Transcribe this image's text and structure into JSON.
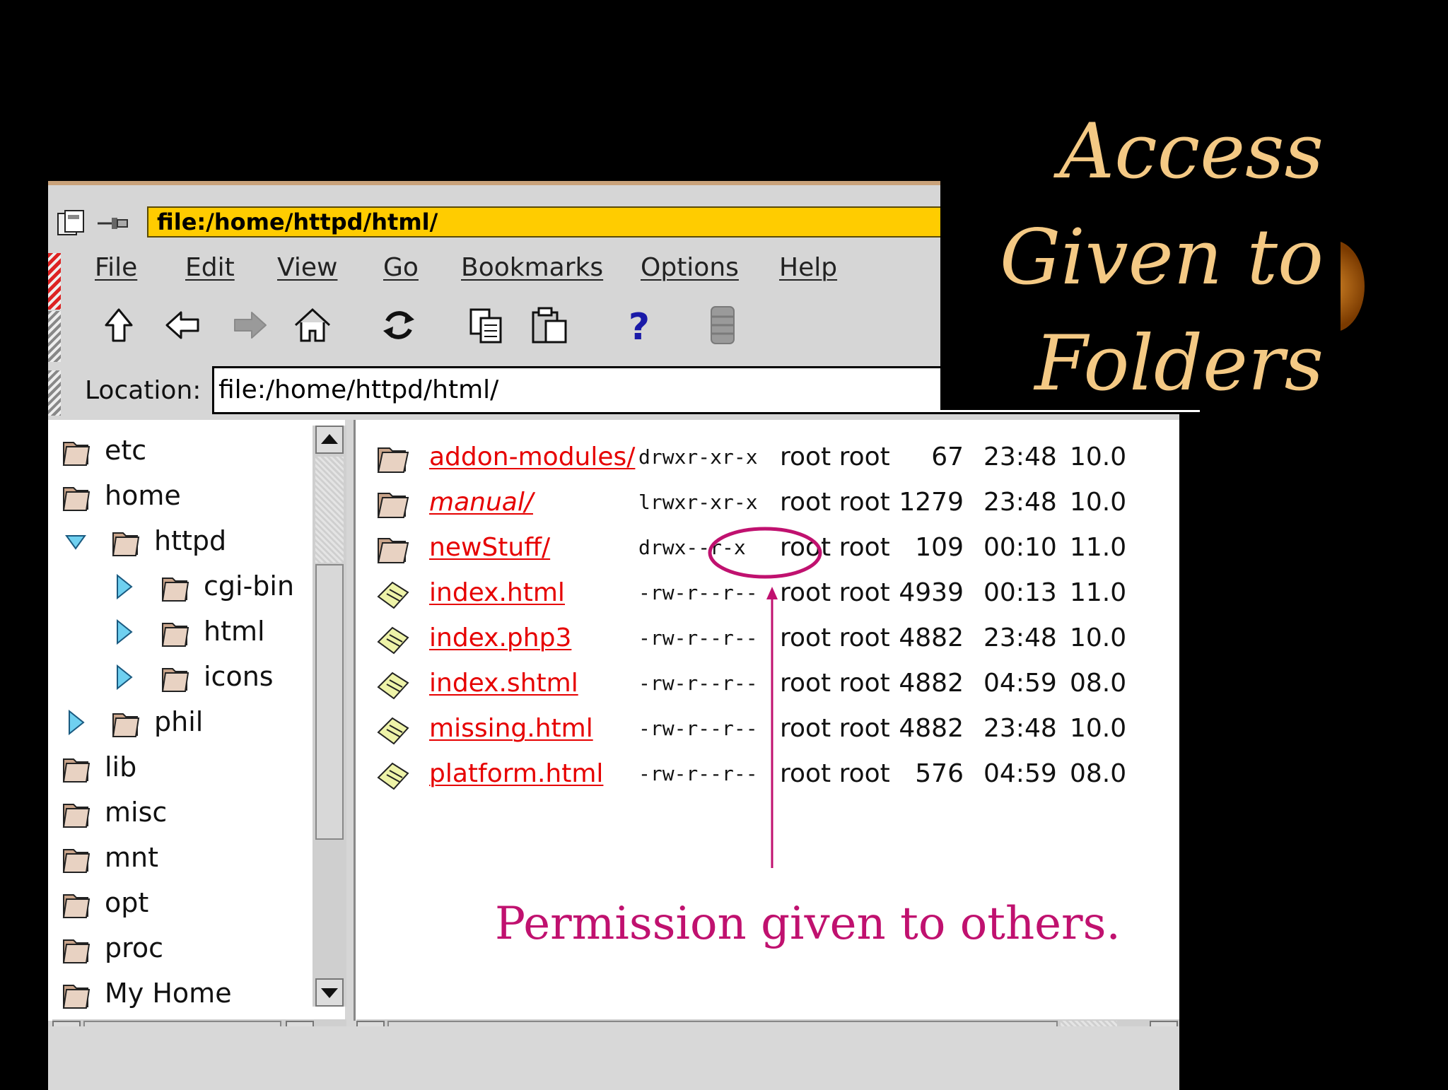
{
  "slide": {
    "title_lines": [
      "Access",
      "Given to",
      "Folders"
    ],
    "annotation": "Permission given to others."
  },
  "browser": {
    "title_path": "file:/home/httpd/html/",
    "menu": [
      {
        "label": "File"
      },
      {
        "label": "Edit"
      },
      {
        "label": "View"
      },
      {
        "label": "Go"
      },
      {
        "label": "Bookmarks"
      },
      {
        "label": "Options"
      },
      {
        "label": "Help"
      }
    ],
    "toolbar_icons": [
      "up-arrow-icon",
      "back-arrow-icon",
      "forward-arrow-icon",
      "home-icon",
      "reload-icon",
      "copy-icon",
      "paste-icon",
      "help-icon",
      "stop-icon"
    ],
    "location_label": "Location:",
    "location_value": "file:/home/httpd/html/"
  },
  "tree": [
    {
      "label": "etc"
    },
    {
      "label": "home"
    },
    {
      "label": "httpd"
    },
    {
      "label": "cgi-bin"
    },
    {
      "label": "html"
    },
    {
      "label": "icons"
    },
    {
      "label": "phil"
    },
    {
      "label": "lib"
    },
    {
      "label": "misc"
    },
    {
      "label": "mnt"
    },
    {
      "label": "opt"
    },
    {
      "label": "proc"
    },
    {
      "label": "My Home"
    }
  ],
  "files": [
    {
      "name": "addon-modules/",
      "perm": "drwxr-xr-x",
      "owner": "root root",
      "size": "67",
      "time": "23:48",
      "date": "10.0"
    },
    {
      "name": "manual/",
      "perm": "lrwxr-xr-x",
      "owner": "root root",
      "size": "1279",
      "time": "23:48",
      "date": "10.0"
    },
    {
      "name": "newStuff/",
      "perm": "drwx--r-x",
      "owner": "root root",
      "size": "109",
      "time": "00:10",
      "date": "11.0"
    },
    {
      "name": "index.html",
      "perm": "-rw-r--r--",
      "owner": "root root",
      "size": "4939",
      "time": "00:13",
      "date": "11.0"
    },
    {
      "name": "index.php3",
      "perm": "-rw-r--r--",
      "owner": "root root",
      "size": "4882",
      "time": "23:48",
      "date": "10.0"
    },
    {
      "name": "index.shtml",
      "perm": "-rw-r--r--",
      "owner": "root root",
      "size": "4882",
      "time": "04:59",
      "date": "08.0"
    },
    {
      "name": "missing.html",
      "perm": "-rw-r--r--",
      "owner": "root root",
      "size": "4882",
      "time": "23:48",
      "date": "10.0"
    },
    {
      "name": "platform.html",
      "perm": "-rw-r--r--",
      "owner": "root root",
      "size": "576",
      "time": "04:59",
      "date": "08.0"
    }
  ],
  "colors": {
    "title_gold": "#f4c984",
    "annotation_magenta": "#c0116f",
    "link_red": "#e60000",
    "title_field_yellow": "#ffcc00"
  }
}
